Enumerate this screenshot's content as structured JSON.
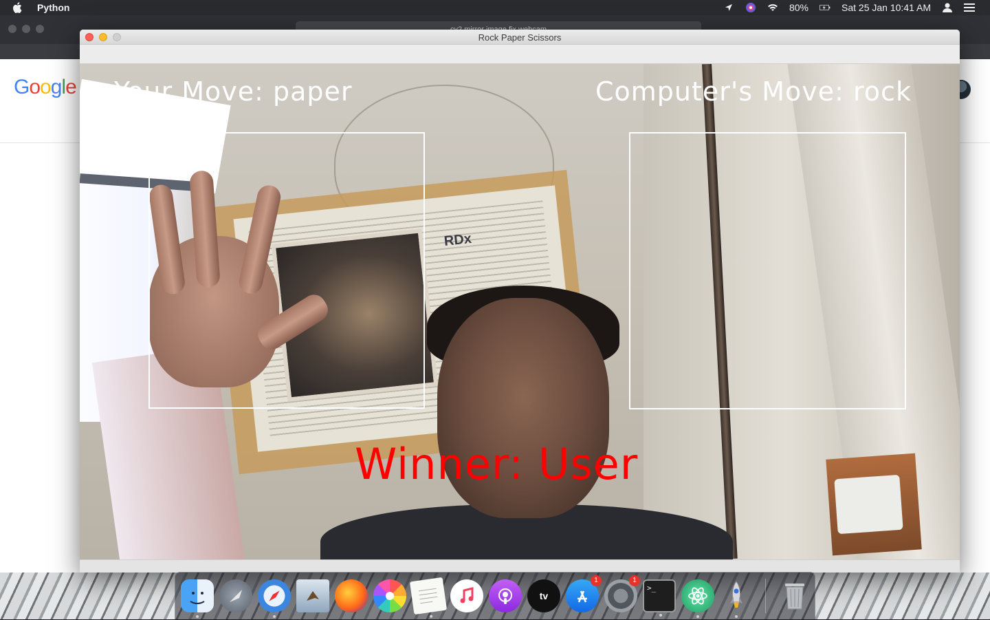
{
  "menubar": {
    "app_name": "Python",
    "battery": "80%",
    "datetime": "Sat 25 Jan  10:41 AM"
  },
  "browser": {
    "url": "cv2 mirror image fix webcam",
    "google_logo": [
      "G",
      "o",
      "o",
      "g",
      "l",
      "e"
    ]
  },
  "window": {
    "title": "Rock Paper Scissors"
  },
  "overlay": {
    "your_move": "Your Move: paper",
    "computer_move": "Computer's Move: rock",
    "winner": "Winner: User",
    "winner_color": "#ff0000",
    "text_color": "#ffffff"
  },
  "dock": {
    "items": [
      {
        "name": "Finder",
        "icon": "finder-icon",
        "running": true
      },
      {
        "name": "Launchpad",
        "icon": "launchpad-icon",
        "running": false
      },
      {
        "name": "Safari",
        "icon": "safari-icon",
        "running": true
      },
      {
        "name": "Mail",
        "icon": "mail-icon",
        "running": false
      },
      {
        "name": "Firefox",
        "icon": "firefox-icon",
        "running": false
      },
      {
        "name": "Photos",
        "icon": "photos-icon",
        "running": false
      },
      {
        "name": "TextEdit",
        "icon": "textedit-icon",
        "running": true
      },
      {
        "name": "Music",
        "icon": "music-icon",
        "running": false
      },
      {
        "name": "Podcasts",
        "icon": "podcasts-icon",
        "running": false
      },
      {
        "name": "TV",
        "icon": "tv-icon",
        "running": false,
        "label": "tv"
      },
      {
        "name": "App Store",
        "icon": "app-store-icon",
        "running": false,
        "badge": "1"
      },
      {
        "name": "System Preferences",
        "icon": "system-preferences-icon",
        "running": false,
        "badge": "1"
      },
      {
        "name": "Terminal",
        "icon": "terminal-icon",
        "running": true,
        "label": ">_"
      },
      {
        "name": "Atom",
        "icon": "atom-icon",
        "running": true
      },
      {
        "name": "Python Launcher",
        "icon": "rocket-icon",
        "running": true
      },
      {
        "name": "Trash",
        "icon": "trash-icon",
        "running": false
      }
    ]
  }
}
